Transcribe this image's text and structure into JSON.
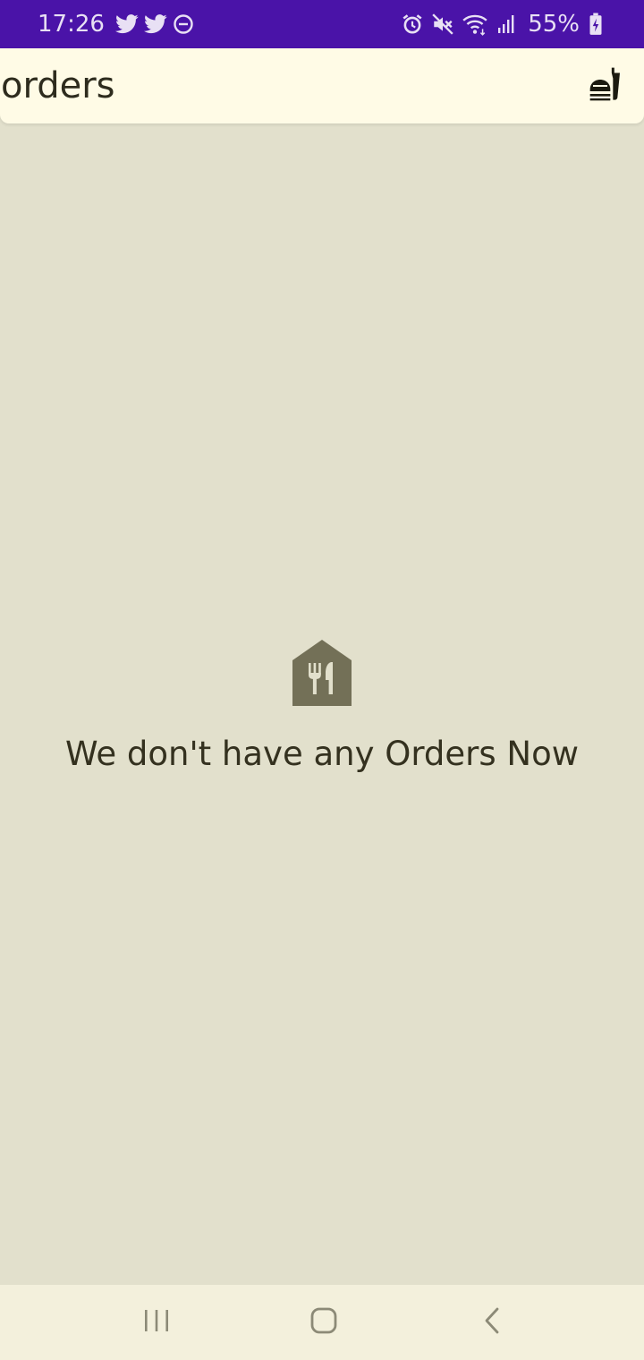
{
  "status_bar": {
    "time": "17:26",
    "battery": "55%",
    "background_color": "#4a13a8",
    "left_icons": [
      "twitter-icon",
      "twitter-icon",
      "do-not-disturb-icon"
    ],
    "right_icons": [
      "alarm-icon",
      "mute-icon",
      "wifi-icon",
      "signal-icon",
      "battery-charging-icon"
    ]
  },
  "app_bar": {
    "title": "orders",
    "action_icon": "fastfood-icon",
    "background_color": "#fffbe6"
  },
  "empty_state": {
    "icon": "restaurant-house-icon",
    "message": "We don't have any Orders Now"
  },
  "nav_bar": {
    "buttons": [
      "recent-apps",
      "home",
      "back"
    ]
  },
  "colors": {
    "page_background": "#e2e0cc",
    "text": "#34311f",
    "icon": "#737057"
  }
}
